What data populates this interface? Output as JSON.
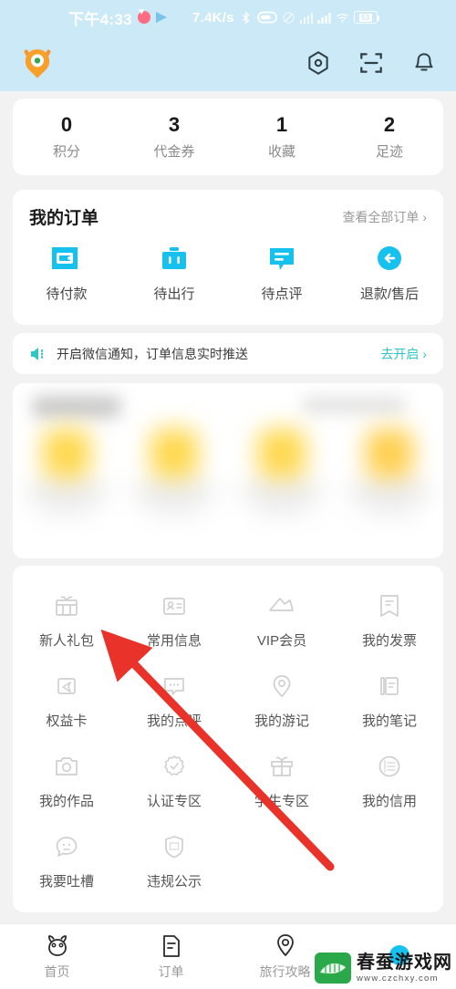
{
  "status_bar": {
    "time": "下午4:33",
    "net_speed": "7.4K/s",
    "battery_text": "53",
    "icons": [
      "heart-icon",
      "telegram-icon",
      "bluetooth-icon",
      "vpn-icon",
      "mute-icon",
      "signal-icon",
      "signal-icon",
      "wifi-icon",
      "battery-icon"
    ]
  },
  "app_bar": {
    "logo": "monster-avatar-logo",
    "actions": [
      {
        "name": "settings-hexagon-icon"
      },
      {
        "name": "qr-scan-icon"
      },
      {
        "name": "notification-bell-icon"
      }
    ]
  },
  "stats": [
    {
      "num": "0",
      "label": "积分"
    },
    {
      "num": "3",
      "label": "代金券"
    },
    {
      "num": "1",
      "label": "收藏"
    },
    {
      "num": "2",
      "label": "足迹"
    }
  ],
  "orders": {
    "title": "我的订单",
    "view_all": "查看全部订单 ›",
    "items": [
      {
        "label": "待付款",
        "icon": "wallet-icon"
      },
      {
        "label": "待出行",
        "icon": "suitcase-icon"
      },
      {
        "label": "待点评",
        "icon": "comment-icon"
      },
      {
        "label": "退款/售后",
        "icon": "refund-icon"
      }
    ]
  },
  "notice": {
    "icon": "speaker-icon",
    "text": "开启微信通知，订单信息实时推送",
    "action": "去开启 ›"
  },
  "grid": [
    {
      "label": "新人礼包",
      "icon": "gift-box-icon"
    },
    {
      "label": "常用信息",
      "icon": "id-card-icon"
    },
    {
      "label": "VIP会员",
      "icon": "crown-icon"
    },
    {
      "label": "我的发票",
      "icon": "invoice-icon"
    },
    {
      "label": "权益卡",
      "icon": "plane-card-icon"
    },
    {
      "label": "我的点评",
      "icon": "comment-dots-icon"
    },
    {
      "label": "我的游记",
      "icon": "location-pin-icon"
    },
    {
      "label": "我的笔记",
      "icon": "notebook-icon"
    },
    {
      "label": "我的作品",
      "icon": "camera-icon"
    },
    {
      "label": "认证专区",
      "icon": "verified-badge-icon"
    },
    {
      "label": "学生专区",
      "icon": "gift-icon"
    },
    {
      "label": "我的信用",
      "icon": "credit-circle-icon"
    },
    {
      "label": "我要吐槽",
      "icon": "feedback-face-icon"
    },
    {
      "label": "违规公示",
      "icon": "penalty-shield-icon"
    }
  ],
  "bottom_nav": [
    {
      "label": "首页",
      "icon": "home-face-icon"
    },
    {
      "label": "订单",
      "icon": "order-doc-icon"
    },
    {
      "label": "旅行攻略",
      "icon": "travel-pin-icon"
    },
    {
      "label": "",
      "icon": "profile-icon"
    }
  ],
  "watermark": {
    "name": "春蚕游戏网",
    "url": "www.czchxy.com"
  },
  "colors": {
    "header_bg": "#cbe9f7",
    "accent_cyan": "#17c1ee",
    "teal_link": "#2ec6c6",
    "arrow_red": "#e8322a",
    "logo_orange": "#f4962a"
  }
}
